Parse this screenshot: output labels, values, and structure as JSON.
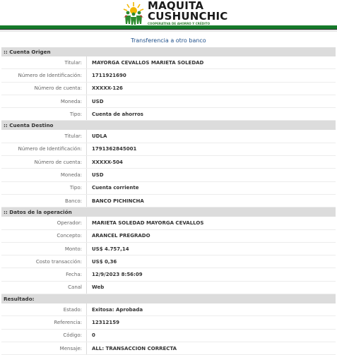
{
  "logo": {
    "line1": "MAQUITA",
    "line2": "CUSHUNCHIC",
    "line3": "COOPERATIVA DE AHORRO Y CRÉDITO"
  },
  "page_title": "Transferencia a otro banco",
  "sections": {
    "origen": {
      "title": ":: Cuenta Origen",
      "rows": [
        {
          "label": "Titular:",
          "value": "MAYORGA CEVALLOS MARIETA SOLEDAD"
        },
        {
          "label": "Número de Identificación:",
          "value": "1711921690"
        },
        {
          "label": "Número de cuenta:",
          "value": "XXXXX-126"
        },
        {
          "label": "Moneda:",
          "value": "USD"
        },
        {
          "label": "Tipo:",
          "value": "Cuenta de ahorros"
        }
      ]
    },
    "destino": {
      "title": ":: Cuenta Destino",
      "rows": [
        {
          "label": "Titular:",
          "value": "UDLA"
        },
        {
          "label": "Número de Identificación:",
          "value": "1791362845001"
        },
        {
          "label": "Número de cuenta:",
          "value": "XXXXX-504"
        },
        {
          "label": "Moneda:",
          "value": "USD"
        },
        {
          "label": "Tipo:",
          "value": "Cuenta corriente"
        },
        {
          "label": "Banco:",
          "value": "BANCO PICHINCHA"
        }
      ]
    },
    "operacion": {
      "title": ":: Datos de la operación",
      "rows": [
        {
          "label": "Operador:",
          "value": "MARIETA SOLEDAD MAYORGA CEVALLOS"
        },
        {
          "label": "Concepto:",
          "value": "ARANCEL PREGRADO"
        },
        {
          "label": "Monto:",
          "value": "US$ 4.757,14"
        },
        {
          "label": "Costo transacción:",
          "value": "US$ 0,36"
        },
        {
          "label": "Fecha:",
          "value": "12/9/2023 8:56:09"
        },
        {
          "label": "Canal",
          "value": "Web"
        }
      ]
    },
    "resultado": {
      "title": "Resultado:",
      "rows": [
        {
          "label": "Estado:",
          "value": "Exitosa: Aprobada"
        },
        {
          "label": "Referencia:",
          "value": "12312159"
        },
        {
          "label": "Código:",
          "value": "0"
        },
        {
          "label": "Mensaje:",
          "value": "ALL: TRANSACCION CORRECTA"
        }
      ]
    }
  }
}
